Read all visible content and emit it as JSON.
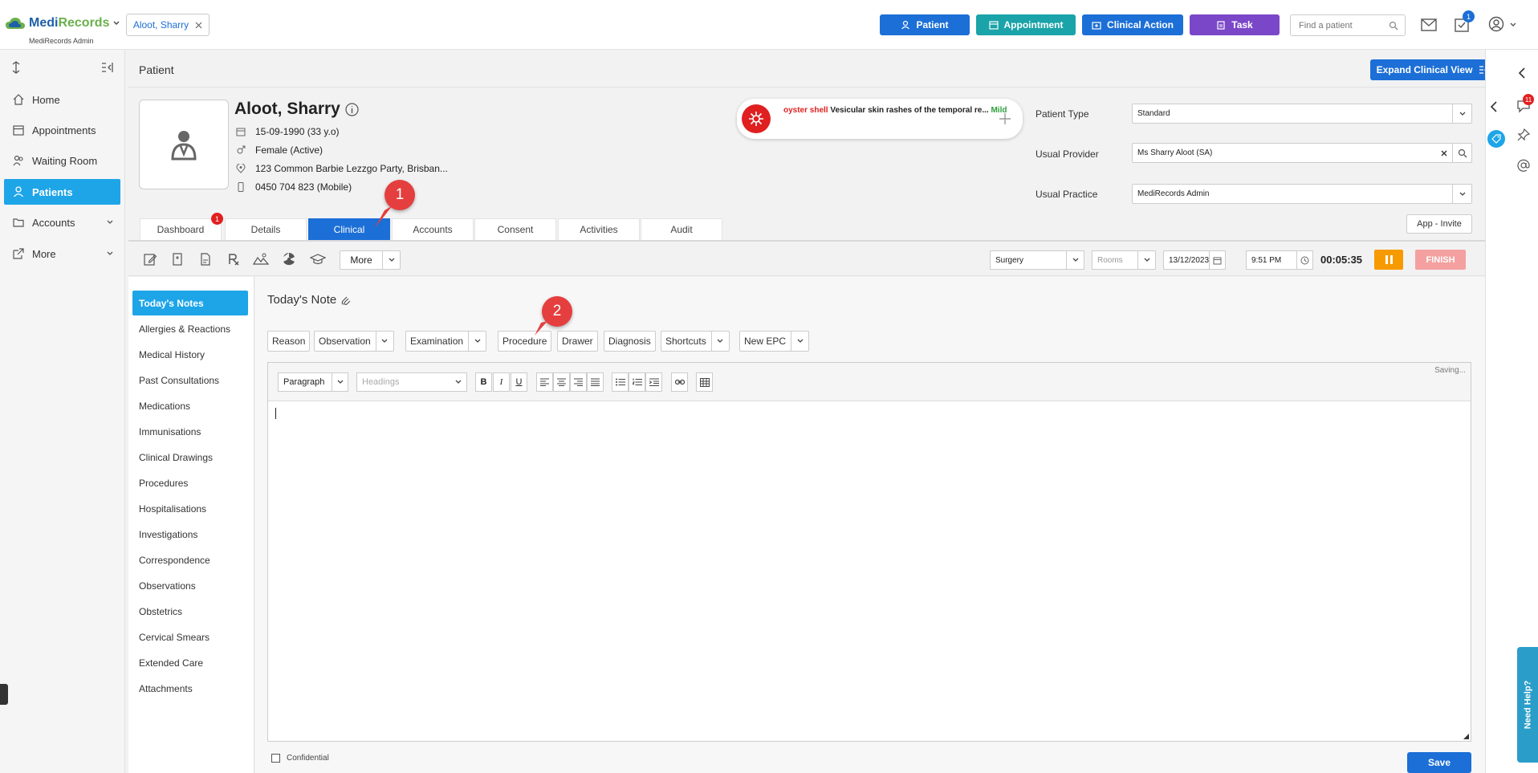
{
  "app": {
    "name_part1": "Medi",
    "name_part2": "Records",
    "subtitle": "MediRecords Admin"
  },
  "open_patient_tab": "Aloot, Sharry",
  "top_actions": {
    "patient": "Patient",
    "appointment": "Appointment",
    "clinical_action": "Clinical Action",
    "task": "Task",
    "find_placeholder": "Find a patient",
    "notification_count": "1"
  },
  "sidebar": {
    "items": [
      {
        "label": "Home",
        "icon": "home-icon"
      },
      {
        "label": "Appointments",
        "icon": "calendar-icon"
      },
      {
        "label": "Waiting Room",
        "icon": "people-icon"
      },
      {
        "label": "Patients",
        "icon": "patient-icon"
      },
      {
        "label": "Accounts",
        "icon": "folder-icon"
      },
      {
        "label": "More",
        "icon": "share-icon"
      }
    ]
  },
  "page": {
    "title": "Patient",
    "expand_label": "Expand Clinical View"
  },
  "patient": {
    "name": "Aloot, Sharry",
    "dob": "15-09-1990 (33 y.o)",
    "gender": "Female (Active)",
    "address": "123 Common Barbie Lezzgo Party, Brisban...",
    "phone": "0450 704 823 (Mobile)"
  },
  "alert": {
    "allergen": "oyster shell",
    "reaction": "Vesicular skin rashes of the temporal re...",
    "severity": "Mild"
  },
  "fields": {
    "patient_type_label": "Patient Type",
    "patient_type_value": "Standard",
    "usual_provider_label": "Usual Provider",
    "usual_provider_value": "Ms Sharry Aloot (SA)",
    "usual_practice_label": "Usual Practice",
    "usual_practice_value": "MediRecords Admin"
  },
  "tabs": [
    {
      "label": "Dashboard",
      "badge": "1"
    },
    {
      "label": "Details"
    },
    {
      "label": "Clinical"
    },
    {
      "label": "Accounts"
    },
    {
      "label": "Consent"
    },
    {
      "label": "Activities"
    },
    {
      "label": "Audit"
    }
  ],
  "app_invite": "App - Invite",
  "clinical_toolbar": {
    "more": "More",
    "location": "Surgery",
    "rooms_placeholder": "Rooms",
    "date": "13/12/2023",
    "time": "9:51 PM",
    "timer": "00:05:35",
    "finish": "FINISH"
  },
  "clinical_menu": [
    "Today's Notes",
    "Allergies & Reactions",
    "Medical History",
    "Past Consultations",
    "Medications",
    "Immunisations",
    "Clinical Drawings",
    "Procedures",
    "Hospitalisations",
    "Investigations",
    "Correspondence",
    "Observations",
    "Obstetrics",
    "Cervical Smears",
    "Extended Care",
    "Attachments"
  ],
  "note": {
    "title": "Today's Note",
    "quick_buttons": [
      "Reason",
      "Observation",
      "Examination",
      "Procedure",
      "Drawer",
      "Diagnosis",
      "Shortcuts",
      "New EPC"
    ],
    "paragraph": "Paragraph",
    "headings_placeholder": "Headings",
    "saving": "Saving...",
    "confidential": "Confidential",
    "save": "Save"
  },
  "markers": {
    "one": "1",
    "two": "2"
  },
  "right_rail": {
    "chat_count": "11",
    "need_help": "Need Help?"
  },
  "colors": {
    "primary": "#1c6fd6",
    "teal": "#1aa3a8",
    "purple": "#7b47c9",
    "active_nav": "#1ea5e8",
    "alert_red": "#e02020",
    "pause_orange": "#f79a00"
  }
}
